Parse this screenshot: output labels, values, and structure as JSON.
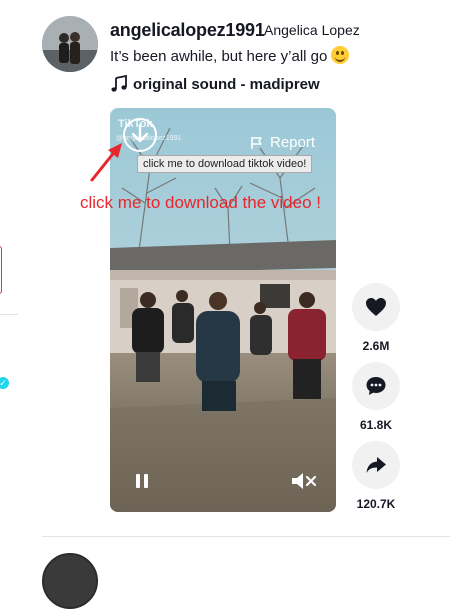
{
  "post": {
    "username": "angelicalopez1991",
    "nickname": "Angelica Lopez",
    "caption": "It’s been awhile, but here y’all go",
    "caption_emoji": "smiling-face-emoji",
    "sound_title": "original sound - madiprew"
  },
  "video": {
    "watermark_brand": "TikTok",
    "watermark_user": "@angelicalopez1991",
    "report_label": "Report",
    "download_tooltip": "click me to download tiktok video!",
    "state": "playing",
    "muted": true,
    "icons": [
      "download-icon",
      "flag-icon",
      "pause-icon",
      "mute-icon"
    ]
  },
  "annotation": {
    "text": "click me to download the video !",
    "color": "#e8262c"
  },
  "actions": [
    {
      "name": "like",
      "icon": "heart-icon",
      "count": "2.6M"
    },
    {
      "name": "comment",
      "icon": "comment-icon",
      "count": "61.8K"
    },
    {
      "name": "share",
      "icon": "share-icon",
      "count": "120.7K"
    }
  ],
  "colors": {
    "text": "#161823",
    "action_bg": "#f1f1f2",
    "divider": "#e3e3e4",
    "annotation": "#e8262c",
    "verified": "#20d5ec"
  }
}
